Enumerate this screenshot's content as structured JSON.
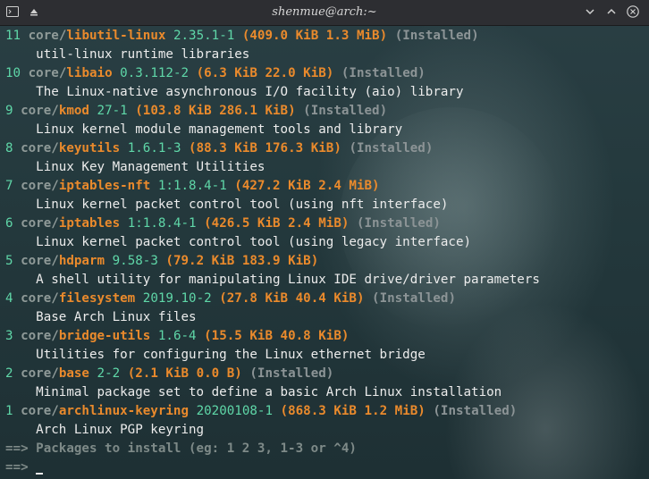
{
  "window": {
    "title": "shenmue@arch:~",
    "icons": [
      "terminal-icon",
      "pin-icon",
      "minimize-icon",
      "maximize-icon",
      "close-icon"
    ]
  },
  "packages": [
    {
      "num": "11",
      "repo": "core",
      "name": "libutil-linux",
      "version": "2.35.1-1",
      "size": "(409.0 KiB 1.3 MiB)",
      "installed": "(Installed)",
      "desc": "util-linux runtime libraries"
    },
    {
      "num": "10",
      "repo": "core",
      "name": "libaio",
      "version": "0.3.112-2",
      "size": "(6.3 KiB 22.0 KiB)",
      "installed": "(Installed)",
      "desc": "The Linux-native asynchronous I/O facility (aio) library"
    },
    {
      "num": "9",
      "repo": "core",
      "name": "kmod",
      "version": "27-1",
      "size": "(103.8 KiB 286.1 KiB)",
      "installed": "(Installed)",
      "desc": "Linux kernel module management tools and library"
    },
    {
      "num": "8",
      "repo": "core",
      "name": "keyutils",
      "version": "1.6.1-3",
      "size": "(88.3 KiB 176.3 KiB)",
      "installed": "(Installed)",
      "desc": "Linux Key Management Utilities"
    },
    {
      "num": "7",
      "repo": "core",
      "name": "iptables-nft",
      "version": "1:1.8.4-1",
      "size": "(427.2 KiB 2.4 MiB)",
      "installed": "",
      "desc": "Linux kernel packet control tool (using nft interface)"
    },
    {
      "num": "6",
      "repo": "core",
      "name": "iptables",
      "version": "1:1.8.4-1",
      "size": "(426.5 KiB 2.4 MiB)",
      "installed": "(Installed)",
      "desc": "Linux kernel packet control tool (using legacy interface)"
    },
    {
      "num": "5",
      "repo": "core",
      "name": "hdparm",
      "version": "9.58-3",
      "size": "(79.2 KiB 183.9 KiB)",
      "installed": "",
      "desc": "A shell utility for manipulating Linux IDE drive/driver parameters"
    },
    {
      "num": "4",
      "repo": "core",
      "name": "filesystem",
      "version": "2019.10-2",
      "size": "(27.8 KiB 40.4 KiB)",
      "installed": "(Installed)",
      "desc": "Base Arch Linux files"
    },
    {
      "num": "3",
      "repo": "core",
      "name": "bridge-utils",
      "version": "1.6-4",
      "size": "(15.5 KiB 40.8 KiB)",
      "installed": "",
      "desc": "Utilities for configuring the Linux ethernet bridge"
    },
    {
      "num": "2",
      "repo": "core",
      "name": "base",
      "version": "2-2",
      "size": "(2.1 KiB 0.0 B)",
      "installed": "(Installed)",
      "desc": "Minimal package set to define a basic Arch Linux installation"
    },
    {
      "num": "1",
      "repo": "core",
      "name": "archlinux-keyring",
      "version": "20200108-1",
      "size": "(868.3 KiB 1.2 MiB)",
      "installed": "(Installed)",
      "desc": "Arch Linux PGP keyring"
    }
  ],
  "prompt": {
    "arrow": "==>",
    "text": "Packages to install (eg: 1 2 3, 1-3 or ^4)",
    "input": ""
  }
}
